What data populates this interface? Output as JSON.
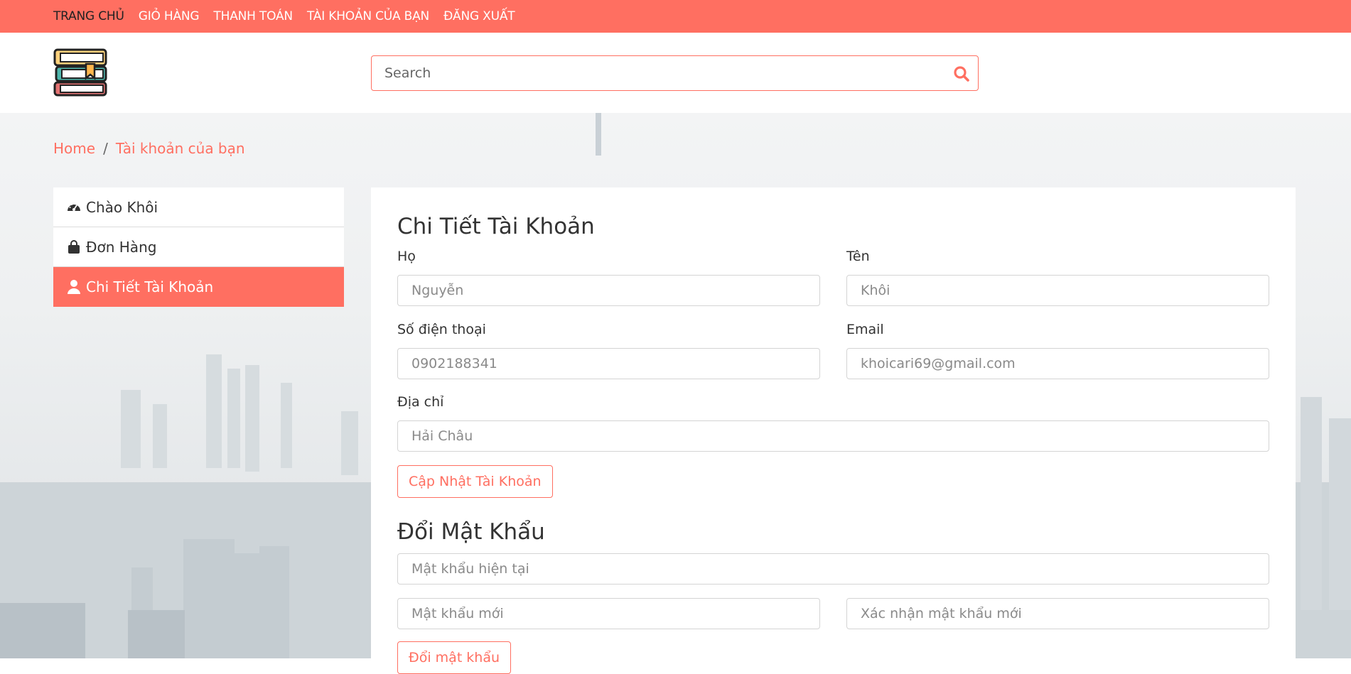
{
  "topnav": {
    "items": [
      "TRANG CHỦ",
      "GIỎ HÀNG",
      "THANH TOÁN",
      "TÀI KHOẢN CỦA BẠN",
      "ĐĂNG XUẤT"
    ]
  },
  "header": {
    "search_placeholder": "Search"
  },
  "breadcrumb": {
    "home": "Home",
    "separator": "/",
    "current": "Tài khoản của bạn"
  },
  "sidebar": {
    "items": [
      {
        "label": "Chào Khôi",
        "icon": "dashboard-icon"
      },
      {
        "label": "Đơn Hàng",
        "icon": "shopping-bag-icon"
      },
      {
        "label": "Chi Tiết Tài Khoản",
        "icon": "user-icon",
        "active": true
      }
    ]
  },
  "account": {
    "title": "Chi Tiết Tài Khoản",
    "last_name_label": "Họ",
    "last_name_placeholder": "Nguyễn",
    "first_name_label": "Tên",
    "first_name_placeholder": "Khôi",
    "phone_label": "Số điện thoại",
    "phone_placeholder": "0902188341",
    "email_label": "Email",
    "email_placeholder": "khoicari69@gmail.com",
    "address_label": "Địa chỉ",
    "address_placeholder": "Hải Châu",
    "update_button": "Cập Nhật Tài Khoản"
  },
  "password": {
    "title": "Đổi Mật Khẩu",
    "current_placeholder": "Mật khẩu hiện tại",
    "new_placeholder": "Mật khẩu mới",
    "confirm_placeholder": "Xác nhận mật khẩu mới",
    "change_button": "Đổi mật khẩu"
  },
  "colors": {
    "accent": "#ff6f61",
    "active_nav_text": "#222222"
  }
}
